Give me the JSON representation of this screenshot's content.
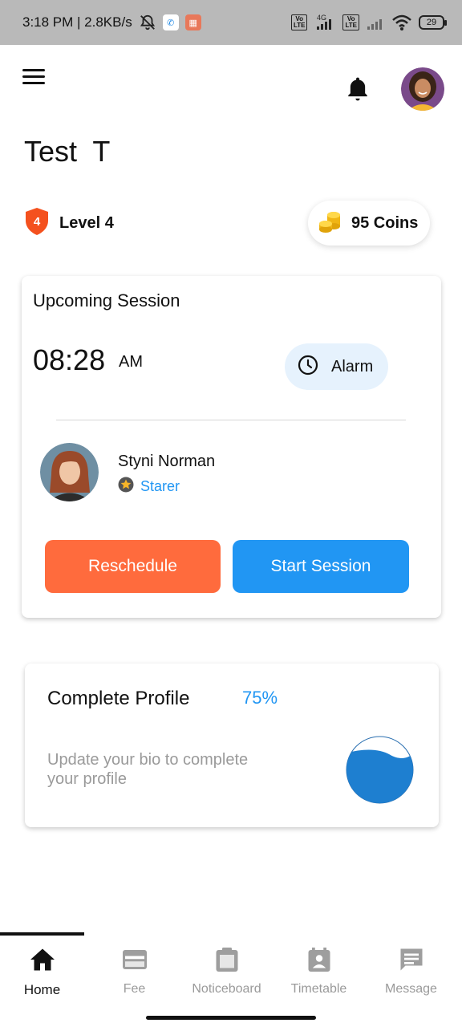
{
  "status_bar": {
    "time_speed": "3:18 PM | 2.8KB/s",
    "network_type": "4G",
    "volte_label": "Vo LTE",
    "battery": "29"
  },
  "header": {
    "menu_icon": "hamburger-menu-icon",
    "notification_icon": "bell-icon",
    "avatar_icon": "user-avatar"
  },
  "user": {
    "name": "Test  T"
  },
  "level": {
    "badge_number": "4",
    "label": "Level 4",
    "badge_color": "#f4511e"
  },
  "coins": {
    "label": "95 Coins",
    "icon": "coin-stack-icon"
  },
  "session": {
    "title": "Upcoming Session",
    "time": "08:28",
    "ampm": "AM",
    "alarm_label": "Alarm",
    "tutor_name": "Styni Norman",
    "tutor_rank": "Starer",
    "reschedule_label": "Reschedule",
    "start_label": "Start Session"
  },
  "profile": {
    "title": "Complete Profile",
    "percent": "75%",
    "progress_value": 0.75,
    "description": "Update your bio to complete your profile"
  },
  "nav": {
    "items": [
      {
        "label": "Home",
        "icon": "home-icon",
        "active": true
      },
      {
        "label": "Fee",
        "icon": "credit-card-icon",
        "active": false
      },
      {
        "label": "Noticeboard",
        "icon": "clipboard-icon",
        "active": false
      },
      {
        "label": "Timetable",
        "icon": "calendar-person-icon",
        "active": false
      },
      {
        "label": "Message",
        "icon": "message-icon",
        "active": false
      }
    ]
  },
  "colors": {
    "accent_blue": "#2196f3",
    "accent_orange": "#ff6b3d",
    "alarm_bg": "#e6f2fd",
    "wave_blue": "#1e7fd0"
  }
}
